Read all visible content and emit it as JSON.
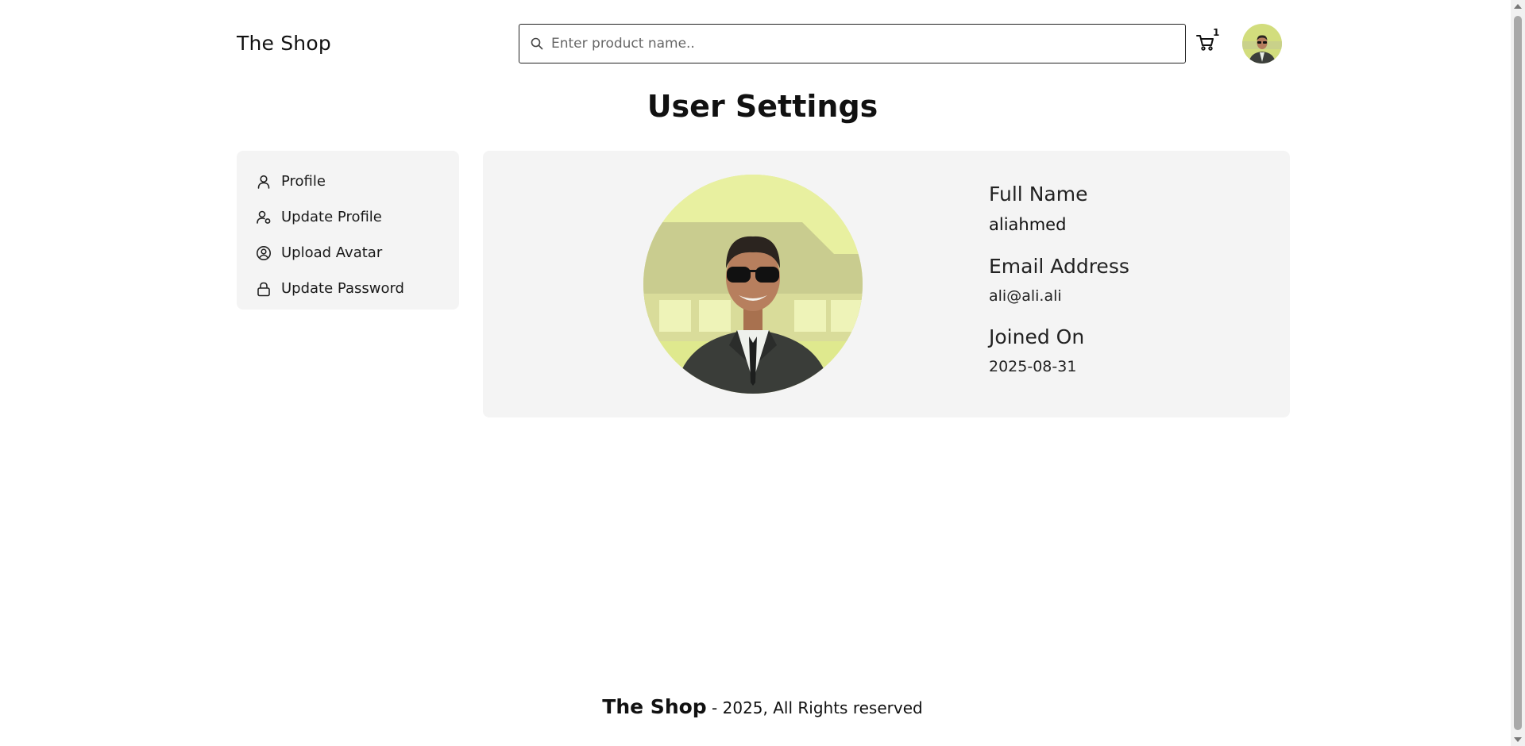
{
  "header": {
    "brand": "The Shop",
    "search": {
      "placeholder": "Enter product name..",
      "value": ""
    },
    "cart_count": "1",
    "search_icon": "search-icon",
    "cart_icon": "cart-icon"
  },
  "page_title": "User Settings",
  "sidebar": {
    "items": [
      {
        "label": "Profile",
        "icon": "user-icon"
      },
      {
        "label": "Update Profile",
        "icon": "user-settings-icon"
      },
      {
        "label": "Upload Avatar",
        "icon": "user-circle-icon"
      },
      {
        "label": "Update Password",
        "icon": "lock-icon"
      }
    ]
  },
  "profile": {
    "full_name_label": "Full Name",
    "full_name": "aliahmed",
    "email_label": "Email Address",
    "email": "ali@ali.ali",
    "joined_label": "Joined On",
    "joined": "2025-08-31"
  },
  "footer": {
    "brand": "The Shop",
    "text": " - 2025, All Rights reserved"
  },
  "colors": {
    "panel_bg": "#f4f4f4",
    "text": "#111111",
    "avatar_bg": "#d7e27a"
  }
}
